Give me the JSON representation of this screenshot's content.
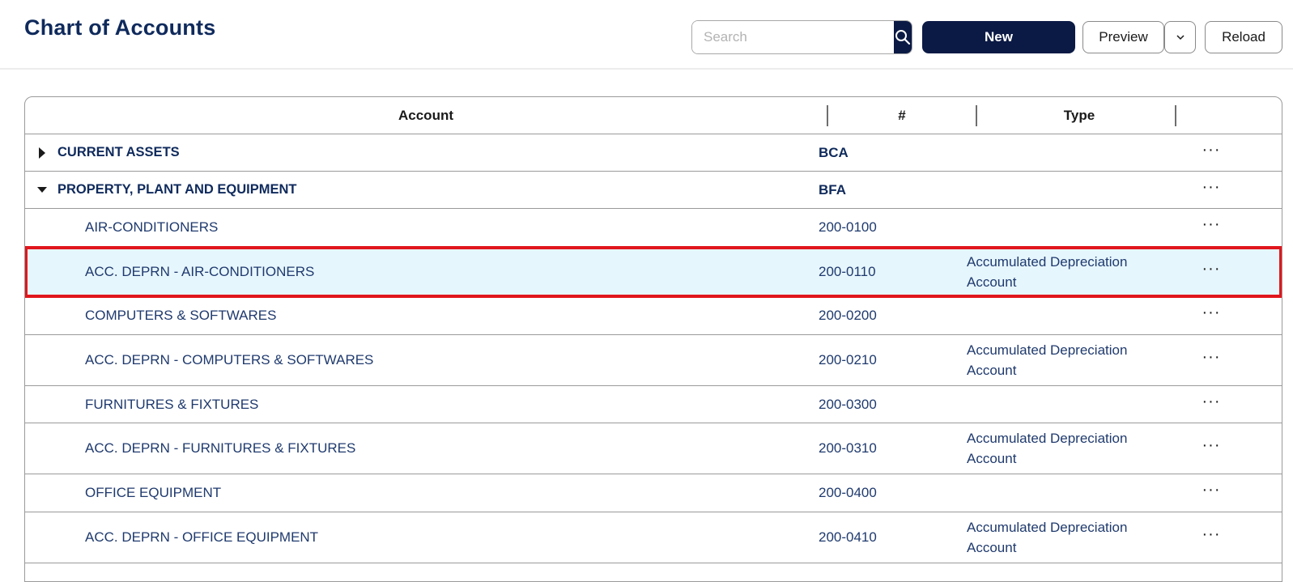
{
  "page": {
    "title": "Chart of Accounts"
  },
  "toolbar": {
    "search_placeholder": "Search",
    "search_icon": "search-icon",
    "new_label": "New",
    "preview_label": "Preview",
    "preview_dropdown_icon": "chevron-down-icon",
    "reload_label": "Reload"
  },
  "table": {
    "headers": {
      "account": "Account",
      "number": "#",
      "type": "Type"
    },
    "more_label": "···",
    "rows": [
      {
        "account": "CURRENT ASSETS",
        "number": "BCA",
        "type": "",
        "group": true,
        "expanded": false
      },
      {
        "account": "PROPERTY, PLANT AND EQUIPMENT",
        "number": "BFA",
        "type": "",
        "group": true,
        "expanded": true
      },
      {
        "account": "AIR-CONDITIONERS",
        "number": "200-0100",
        "type": ""
      },
      {
        "account": "ACC. DEPRN - AIR-CONDITIONERS",
        "number": "200-0110",
        "type": "Accumulated Depreciation Account",
        "selected": true
      },
      {
        "account": "COMPUTERS & SOFTWARES",
        "number": "200-0200",
        "type": ""
      },
      {
        "account": "ACC. DEPRN - COMPUTERS & SOFTWARES",
        "number": "200-0210",
        "type": "Accumulated Depreciation Account"
      },
      {
        "account": "FURNITURES & FIXTURES",
        "number": "200-0300",
        "type": ""
      },
      {
        "account": "ACC. DEPRN - FURNITURES & FIXTURES",
        "number": "200-0310",
        "type": "Accumulated Depreciation Account"
      },
      {
        "account": "OFFICE EQUIPMENT",
        "number": "200-0400",
        "type": ""
      },
      {
        "account": "ACC. DEPRN - OFFICE EQUIPMENT",
        "number": "200-0410",
        "type": "Accumulated Depreciation Account"
      }
    ]
  },
  "colors": {
    "primary": "#0b1a45",
    "text": "#1f3a6e",
    "selected_bg": "#e6f6fd",
    "selected_border": "#e0161c"
  }
}
